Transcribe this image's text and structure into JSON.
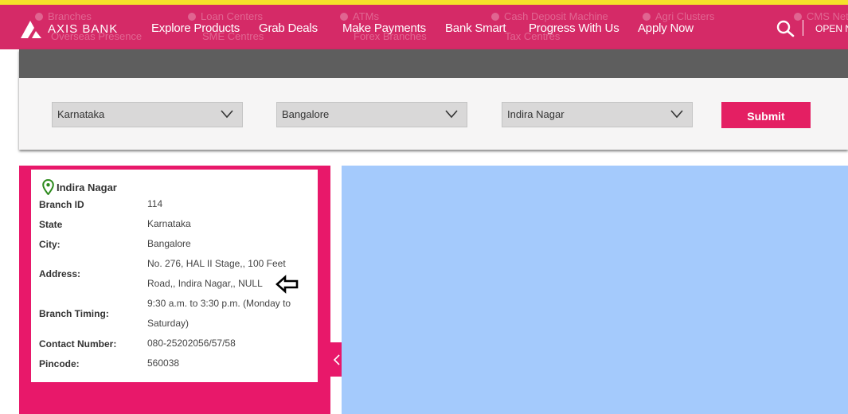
{
  "brand": {
    "name": "AXIS BANK"
  },
  "nav": {
    "items": [
      "Explore Products",
      "Grab Deals",
      "Make Payments",
      "Bank Smart",
      "Progress With Us",
      "Apply Now"
    ],
    "open_label": "OPEN N"
  },
  "bg_filters": [
    "Branches",
    "Overseas Presence",
    "Loan Centers",
    "SME Centres",
    "ATMs",
    "Forex Branches",
    "Cash Deposit Machine",
    "Tax Centres",
    "Agri Clusters",
    "CMS Net"
  ],
  "filters": {
    "state": "Karnataka",
    "city": "Bangalore",
    "locality": "Indira Nagar",
    "submit_label": "Submit"
  },
  "branch": {
    "title": "Indira Nagar",
    "labels": {
      "branch_id": "Branch ID",
      "state": "State",
      "city": "City:",
      "address": "Address:",
      "timing": "Branch Timing:",
      "contact": "Contact Number:",
      "pincode": "Pincode:"
    },
    "values": {
      "branch_id": "114",
      "state": "Karnataka",
      "city": "Bangalore",
      "address": "No. 276, HAL II Stage,, 100 Feet Road,, Indira Nagar,, NULL",
      "timing": "9:30 a.m. to 3:30 p.m. (Monday to Saturday)",
      "contact": "080-25202056/57/58",
      "pincode": "560038"
    }
  },
  "colors": {
    "nav_bg": "#d52a67",
    "accent_pink": "#e8186a",
    "submit_bg": "#e41f63",
    "map_bg": "#a4cafc",
    "top_stripe": "#f5e12a",
    "pin_green": "#2e8b1e"
  },
  "icons": {
    "search": "search-icon",
    "pin": "map-pin-icon",
    "arrow": "arrow-left-icon",
    "collapse": "chevron-left-icon",
    "dropdown": "chevron-down-icon"
  }
}
